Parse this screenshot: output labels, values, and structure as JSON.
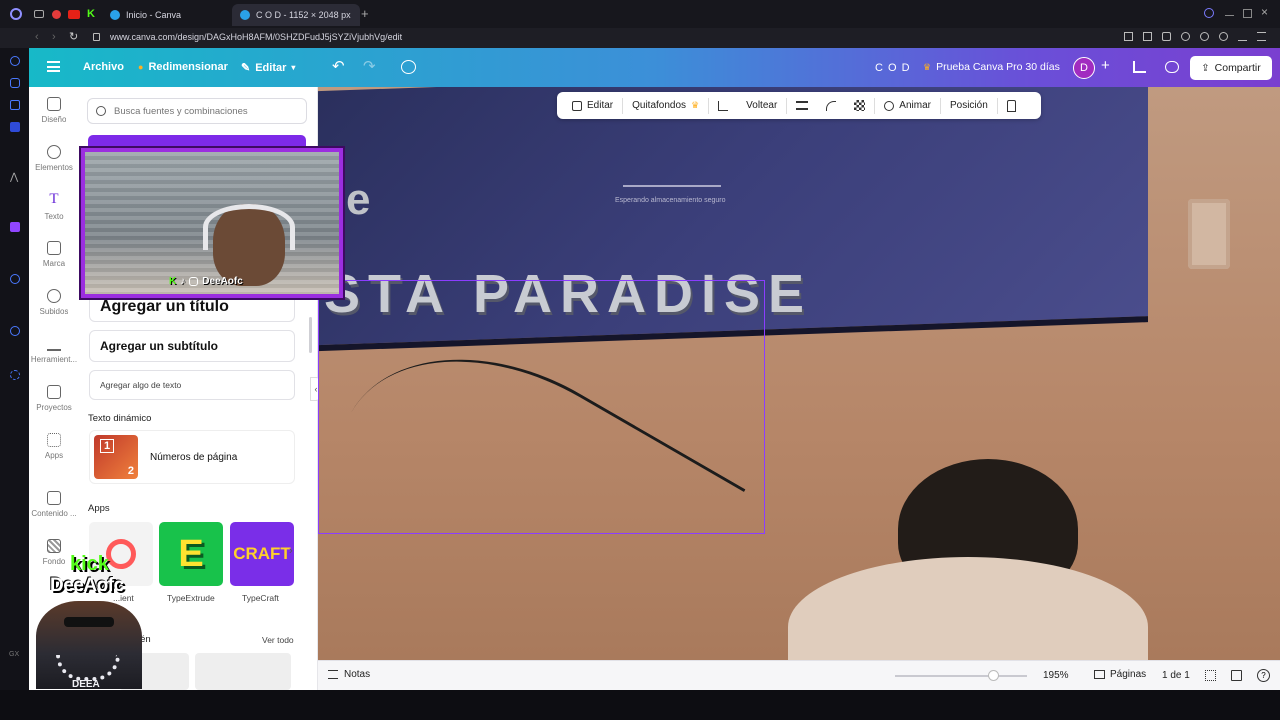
{
  "browser": {
    "tabs": [
      {
        "label": "Inicio - Canva"
      },
      {
        "label": "C O D - 1152 × 2048 px"
      }
    ],
    "url": "www.canva.com/design/DAGxHoH8AFM/0SHZDFudJ5jSYZiVjubhVg/edit"
  },
  "topbar": {
    "archivo": "Archivo",
    "redimensionar": "Redimensionar",
    "editar": "Editar",
    "title": "C O D",
    "pro": "Prueba Canva Pro 30 días",
    "avatar": "D",
    "compartir": "Compartir"
  },
  "rail": [
    {
      "label": "Diseño"
    },
    {
      "label": "Elementos"
    },
    {
      "label": "Texto"
    },
    {
      "label": "Marca"
    },
    {
      "label": "Subidos"
    },
    {
      "label": "Herramient..."
    },
    {
      "label": "Proyectos"
    },
    {
      "label": "Apps"
    },
    {
      "label": "Contenido ..."
    },
    {
      "label": "Fondo"
    }
  ],
  "panel": {
    "search_placeholder": "Busca fuentes y combinaciones",
    "add_title": "Agregar un título",
    "add_subtitle": "Agregar un subtítulo",
    "add_text": "Agregar algo de texto",
    "dynamic_heading": "Texto dinámico",
    "page_numbers": "Números de página",
    "page_num_top": "1",
    "page_num_bottom": "2",
    "apps_heading": "Apps",
    "apps": [
      {
        "label": "...ient"
      },
      {
        "label": "TypeExtrude",
        "glyph": "E"
      },
      {
        "label": "TypeCraft",
        "glyph": "CRAFT"
      }
    ],
    "recent_heading": "...o recién",
    "see_all": "Ver todo"
  },
  "context_toolbar": {
    "editar": "Editar",
    "quitafondos": "Quitafondos",
    "voltear": "Voltear",
    "animar": "Animar",
    "posicion": "Posición"
  },
  "canvas": {
    "headline": "STA PARADISE",
    "partial_letter": "e",
    "tv_caption": "Esperando almacenamiento seguro"
  },
  "bottom": {
    "notas": "Notas",
    "zoom": "195%",
    "paginas": "Páginas",
    "page_count": "1 de 1"
  },
  "overlay": {
    "webcam_name": "DeeAofc",
    "kick_label": "kick",
    "avatar_name": "DeeAofc",
    "chain_text": "DEEA"
  },
  "colors": {
    "accent_purple": "#8b3dff",
    "topbar_start": "#17b9c8",
    "topbar_end": "#7a3fd0"
  }
}
